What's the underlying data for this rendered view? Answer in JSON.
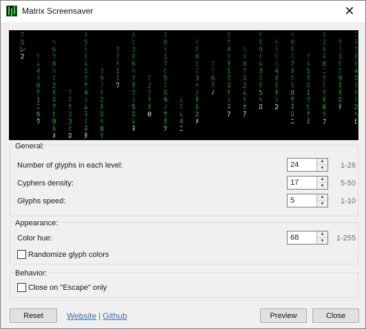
{
  "window": {
    "title": "Matrix Screensaver",
    "close_icon": "close-icon",
    "app_icon": "matrix-app-icon"
  },
  "colors": {
    "glyph_green": "#2fd32f",
    "glyph_bright": "#b6ffb6",
    "preview_bg": "#000000",
    "link": "#3b6ea5"
  },
  "preview": {
    "columns": [
      "7Q㆑2",
      "ﾘﾑ4ﾗ0ﾁ1ﾆ8ｳ",
      "ﾍ6ｳ8ﾊﾐ2ﾀﾎｱﾋ9ﾙﾒ",
      "ﾏ7ｻﾕ3ﾃﾛ",
      "ﾇ5ﾄﾓﾙ1ﾂﾔ4ﾝﾑｽﾐﾈﾀ",
      "ﾖ9ﾉﾃ2ﾎﾛﾍ8ﾘﾝ",
      "ﾀ7ｷ1ﾐﾜ",
      "ﾙﾋ3ﾎ6ﾍｱﾀﾂﾝ5ﾛﾚﾈ",
      "ﾅ2ﾂﾃﾎ0",
      "ﾈ8ﾃ1ﾜﾋ5ﾐﾛ9ﾉｻﾀﾂ",
      "ﾑｳﾚ4ﾆ",
      "ﾄﾎ0ﾋﾐ3ﾍﾝﾀﾙ2ﾒ",
      "ﾂﾐ6ﾃﾉ",
      "ﾅﾔ4ﾘﾀ1ｳﾛﾅﾝﾈ7",
      "ﾊﾒ8ﾅﾛ2ﾑﾄｾｱ",
      "ﾁﾎ9ﾄﾙ3ﾐﾃ5ﾍﾛ",
      "ﾒﾗﾘﾐ4ｵﾃﾀﾝ2",
      "ﾍ0ﾎﾐ7ﾀﾂﾘ8ｻﾈﾛﾆ",
      "ﾃﾙ5ﾀﾛ1ﾂﾋﾅﾐ",
      "ﾎ2ﾙﾈ8ﾆﾃﾐﾂﾀ6ﾘﾌ",
      "ﾀﾐ3ﾋﾂ9ﾈﾎﾛﾃ",
      "ﾆﾈ7ﾀﾎ4ﾛﾘﾃﾐ2ﾍﾋ"
    ]
  },
  "general": {
    "title": "General:",
    "fields": [
      {
        "label": "Number of glyphs in each level:",
        "value": "24",
        "range": "1-26"
      },
      {
        "label": "Cyphers density:",
        "value": "17",
        "range": "5-50"
      },
      {
        "label": "Glyphs speed:",
        "value": "5",
        "range": "1-10"
      }
    ]
  },
  "appearance": {
    "title": "Appearance:",
    "color_hue": {
      "label": "Color hue:",
      "value": "68",
      "range": "1-255"
    },
    "randomize": {
      "label": "Randomize glyph colors",
      "checked": false
    }
  },
  "behavior": {
    "title": "Behavior:",
    "close_escape": {
      "label": "Close on \"Escape\" only",
      "checked": false
    }
  },
  "footer": {
    "reset": "Reset",
    "website": "Website",
    "separator": "|",
    "github": "Github",
    "preview": "Preview",
    "close": "Close"
  }
}
